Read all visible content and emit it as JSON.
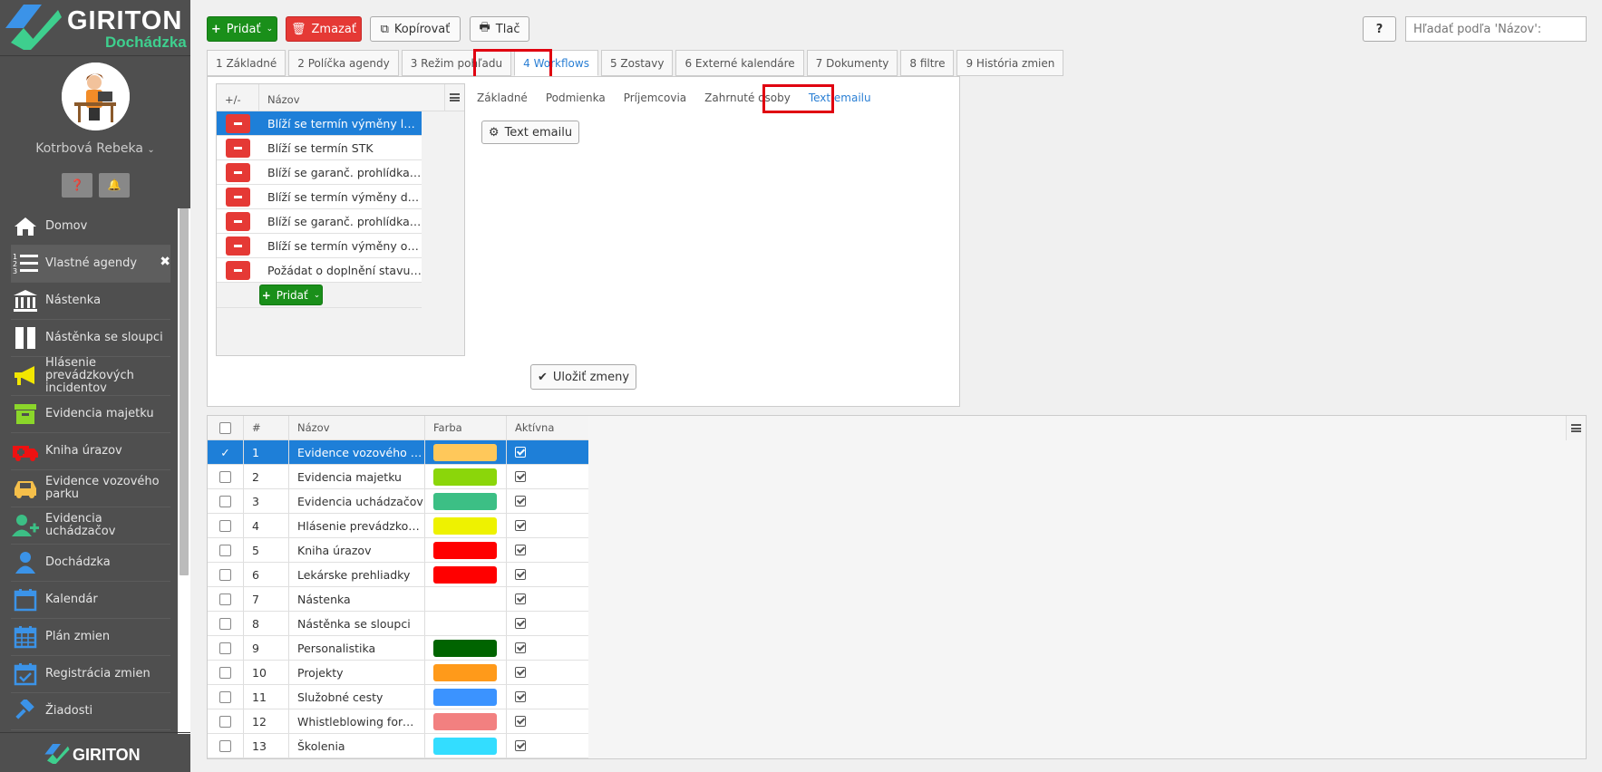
{
  "brand": {
    "name": "GIRITON",
    "product": "Dochádzka",
    "footer": "GIRITON"
  },
  "user": {
    "name": "Kotrbová Rebeka"
  },
  "sidebar": {
    "items": [
      {
        "label": "Domov",
        "icon": "home-icon",
        "color": "#ffffff"
      },
      {
        "label": "Vlastné agendy",
        "icon": "list-icon",
        "color": "#ffffff",
        "active": true
      },
      {
        "label": "Nástenka",
        "icon": "bank-icon",
        "color": "#ffffff"
      },
      {
        "label": "Nástěnka se sloupci",
        "icon": "columns-icon",
        "color": "#ffffff"
      },
      {
        "label": "Hlásenie prevádzkových incidentov",
        "icon": "megaphone-icon",
        "color": "#f2e600"
      },
      {
        "label": "Evidencia majetku",
        "icon": "archive-icon",
        "color": "#8bd62a"
      },
      {
        "label": "Kniha úrazov",
        "icon": "ambulance-icon",
        "color": "#ee1111"
      },
      {
        "label": "Evidence vozového parku",
        "icon": "car-icon",
        "color": "#f5bf4a"
      },
      {
        "label": "Evidencia uchádzačov",
        "icon": "user-plus-icon",
        "color": "#3cbf85"
      },
      {
        "label": "Dochádzka",
        "icon": "user-icon",
        "color": "#3b93e8"
      },
      {
        "label": "Kalendár",
        "icon": "calendar-icon",
        "color": "#3b93e8"
      },
      {
        "label": "Plán zmien",
        "icon": "calendar-grid-icon",
        "color": "#3b93e8"
      },
      {
        "label": "Registrácia zmien",
        "icon": "calendar-check-icon",
        "color": "#3b93e8"
      },
      {
        "label": "Žiadosti",
        "icon": "gavel-icon",
        "color": "#3b93e8"
      }
    ]
  },
  "toolbar": {
    "add": "Pridať",
    "delete": "Zmazať",
    "copy": "Kopírovať",
    "print": "Tlač"
  },
  "search": {
    "placeholder": "Hľadať podľa 'Názov':"
  },
  "tabs": [
    "1 Základné",
    "2 Políčka agendy",
    "3 Režim pohľadu",
    "4 Workflows",
    "5 Zostavy",
    "6 Externé kalendáre",
    "7 Dokumenty",
    "8 filtre",
    "9 História zmien"
  ],
  "active_tab": 3,
  "workflows": {
    "col_toggle": "+/-",
    "col_name": "Názov",
    "rows": [
      "Blíží se termín výměny lékárny",
      "Blíží se termín STK",
      "Blíží se garanč. prohlídka vozidla",
      "Blíží se termín výměny dálniční známky",
      "Blíží se garanč. prohlídka vozidla",
      "Blíží se termín výměny oleje",
      "Požádat o doplnění stavu tachometru"
    ],
    "selected": 0,
    "add": "Pridať"
  },
  "subtabs": [
    "Základné",
    "Podmienka",
    "Príjemcovia",
    "Zahrnuté osoby",
    "Text emailu"
  ],
  "active_subtab": 4,
  "email_text_button": "Text emailu",
  "save_button": "Uložiť zmeny",
  "agendas": {
    "headers": {
      "num": "#",
      "name": "Názov",
      "color": "Farba",
      "active": "Aktívna"
    },
    "rows": [
      {
        "num": "1",
        "name": "Evidence vozového parku",
        "color": "#ffc85a",
        "active": true
      },
      {
        "num": "2",
        "name": "Evidencia majetku",
        "color": "#8bd60a",
        "active": true
      },
      {
        "num": "3",
        "name": "Evidencia uchádzačov",
        "color": "#3cbf85",
        "active": true
      },
      {
        "num": "4",
        "name": "Hlásenie prevádzkových incidentov",
        "color": "#eef200",
        "active": true
      },
      {
        "num": "5",
        "name": "Kniha úrazov",
        "color": "#ff0000",
        "active": true
      },
      {
        "num": "6",
        "name": "Lekárske prehliadky",
        "color": "#ff0000",
        "active": true
      },
      {
        "num": "7",
        "name": "Nástenka",
        "color": "",
        "active": true
      },
      {
        "num": "8",
        "name": "Nástěnka se sloupci",
        "color": "#ffffff",
        "active": true
      },
      {
        "num": "9",
        "name": "Personalistika",
        "color": "#006400",
        "active": true
      },
      {
        "num": "10",
        "name": "Projekty",
        "color": "#ff9a1a",
        "active": true
      },
      {
        "num": "11",
        "name": "Služobné cesty",
        "color": "#3b93ff",
        "active": true
      },
      {
        "num": "12",
        "name": "Whistleblowing formulár",
        "color": "#f28080",
        "active": true
      },
      {
        "num": "13",
        "name": "Školenia",
        "color": "#33ddff",
        "active": true
      }
    ],
    "selected": 0
  }
}
